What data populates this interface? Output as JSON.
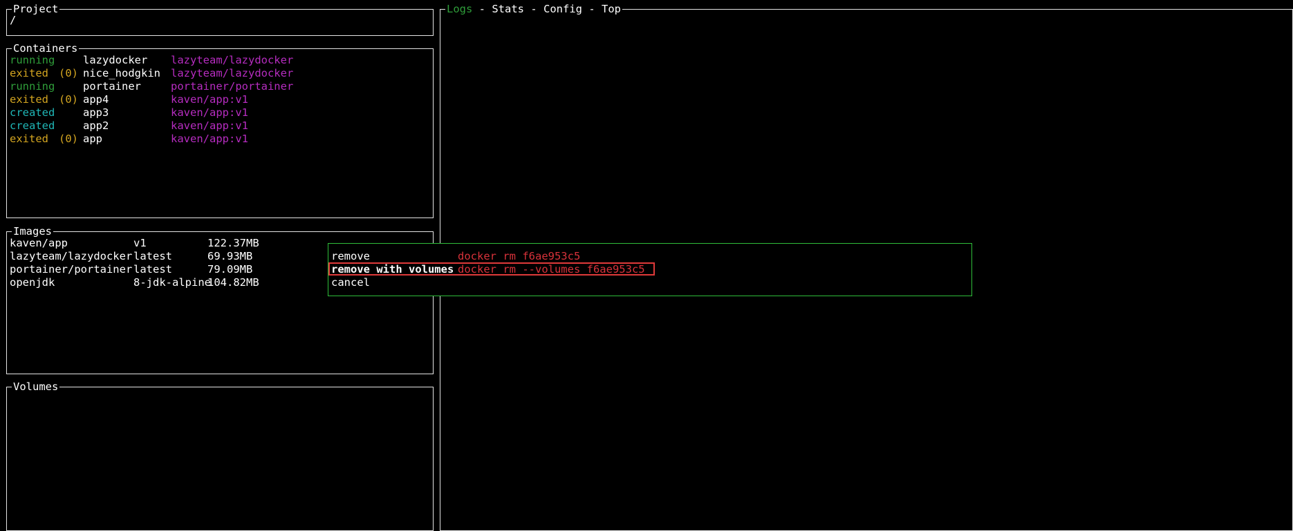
{
  "colors": {
    "running": "#2f9e3a",
    "exited": "#d3a520",
    "created": "#1fb7b7",
    "image": "#b62cc0",
    "command": "#d8323a",
    "active_tab": "#2f9e3a",
    "menu_border": "#2fbf3a"
  },
  "project": {
    "title": "Project",
    "path": "/"
  },
  "containers": {
    "title": "Containers",
    "rows": [
      {
        "status": "running",
        "exit": "",
        "name": "lazydocker",
        "image": "lazyteam/lazydocker"
      },
      {
        "status": "exited",
        "exit": "(0)",
        "name": "nice_hodgkin",
        "image": "lazyteam/lazydocker"
      },
      {
        "status": "running",
        "exit": "",
        "name": "portainer",
        "image": "portainer/portainer"
      },
      {
        "status": "exited",
        "exit": "(0)",
        "name": "app4",
        "image": "kaven/app:v1"
      },
      {
        "status": "created",
        "exit": "",
        "name": "app3",
        "image": "kaven/app:v1"
      },
      {
        "status": "created",
        "exit": "",
        "name": "app2",
        "image": "kaven/app:v1"
      },
      {
        "status": "exited",
        "exit": "(0)",
        "name": "app",
        "image": "kaven/app:v1"
      }
    ]
  },
  "images": {
    "title": "Images",
    "rows": [
      {
        "repo": "kaven/app",
        "tag": "v1",
        "size": "122.37MB"
      },
      {
        "repo": "lazyteam/lazydocker",
        "tag": "latest",
        "size": "69.93MB"
      },
      {
        "repo": "portainer/portainer",
        "tag": "latest",
        "size": "79.09MB"
      },
      {
        "repo": "openjdk",
        "tag": "8-jdk-alpine",
        "size": "104.82MB"
      }
    ]
  },
  "volumes": {
    "title": "Volumes"
  },
  "main": {
    "tabs": [
      "Logs",
      "Stats",
      "Config",
      "Top"
    ],
    "separator": " - ",
    "active_tab": 0
  },
  "menu": {
    "selected": 1,
    "items": [
      {
        "label": "remove",
        "command": "docker rm f6ae953c5"
      },
      {
        "label": "remove with volumes",
        "command": "docker rm --volumes f6ae953c5"
      },
      {
        "label": "cancel",
        "command": ""
      }
    ]
  }
}
